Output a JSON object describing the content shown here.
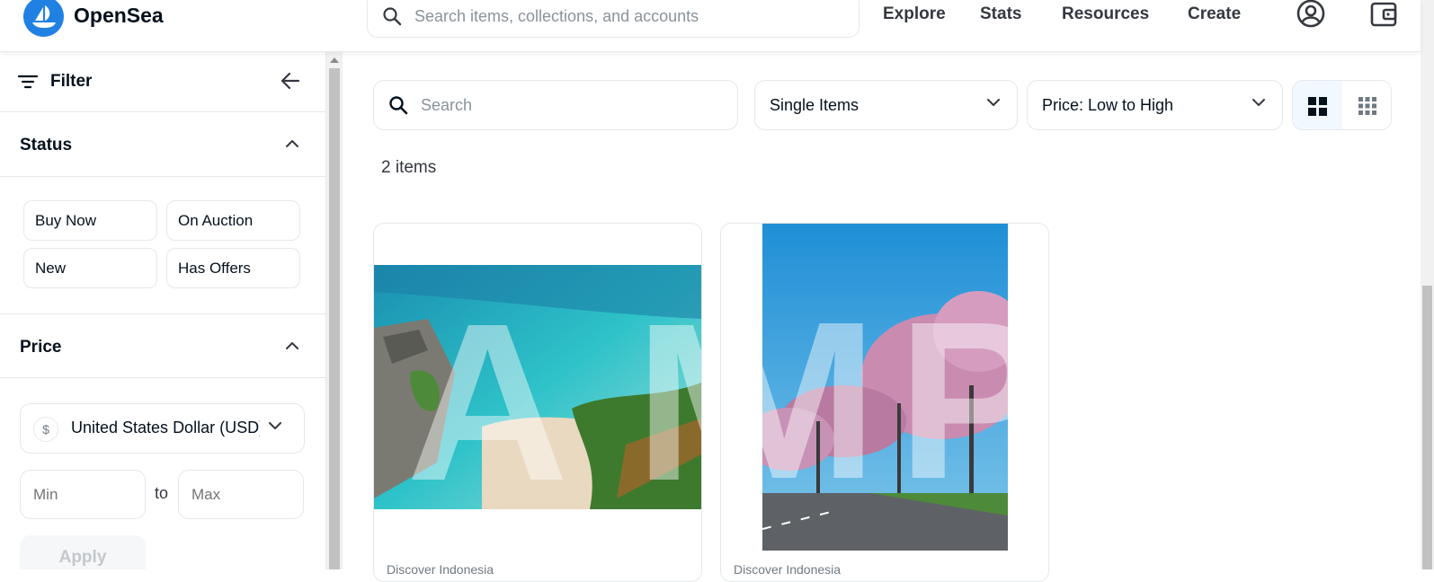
{
  "app": {
    "brand": "OpenSea",
    "accent": "#2081e2"
  },
  "header": {
    "search_placeholder": "Search items, collections, and accounts",
    "nav": [
      "Explore",
      "Stats",
      "Resources",
      "Create"
    ],
    "icons": [
      "account-icon",
      "wallet-icon"
    ]
  },
  "sidebar": {
    "filter_label": "Filter",
    "status": {
      "title": "Status",
      "options": [
        "Buy Now",
        "On Auction",
        "New",
        "Has Offers"
      ]
    },
    "price": {
      "title": "Price",
      "currency": "United States Dollar (USD)",
      "currency_symbol": "$",
      "min_placeholder": "Min",
      "to_label": "to",
      "max_placeholder": "Max",
      "apply_label": "Apply"
    }
  },
  "main": {
    "search_placeholder": "Search",
    "item_type": "Single Items",
    "sort": "Price: Low to High",
    "item_count": "2 items",
    "cards": [
      {
        "collection": "Discover Indonesia",
        "image": "beach-cliff-photo"
      },
      {
        "collection": "Discover Indonesia",
        "image": "flowering-trees-road-photo"
      }
    ],
    "watermark": [
      "A",
      "M",
      "M",
      "P"
    ]
  }
}
